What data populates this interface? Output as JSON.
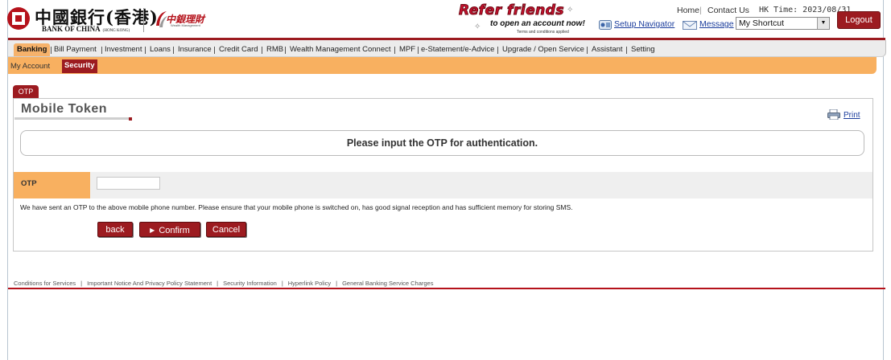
{
  "brand": {
    "name_cn": "中國銀行(香港)",
    "name_en": "BANK OF CHINA",
    "name_en_small": "(HONG KONG)",
    "wealth_cn": "中銀理財",
    "wealth_en": "Wealth Management"
  },
  "promo": {
    "headline": "Refer friends",
    "sub": "to open an account now!",
    "terms": "Terms and conditions applied"
  },
  "header": {
    "home": "Home",
    "contact": "Contact Us",
    "time_label": "HK Time: 2023/08/31",
    "setup_navigator": "Setup Navigator",
    "message": "Message",
    "shortcut_value": "My Shortcut",
    "logout": "Logout"
  },
  "menu": [
    {
      "label": "Banking"
    },
    {
      "label": "Bill Payment"
    },
    {
      "label": "Investment"
    },
    {
      "label": "Loans"
    },
    {
      "label": "Insurance"
    },
    {
      "label": "Credit Card"
    },
    {
      "label": "RMB"
    },
    {
      "label": "Wealth Management Connect"
    },
    {
      "label": "MPF"
    },
    {
      "label": "e-Statement/e-Advice"
    },
    {
      "label": "Upgrade / Open Service"
    },
    {
      "label": "Assistant"
    },
    {
      "label": "Setting"
    }
  ],
  "submenu": [
    {
      "label": "My Account"
    },
    {
      "label": "Security"
    }
  ],
  "page": {
    "tab": "OTP",
    "title": "Mobile Token",
    "print": "Print",
    "prompt": "Please input the OTP for authentication.",
    "otp_label": "OTP",
    "notice": "We have sent an OTP to the above mobile phone number. Please ensure that your mobile phone is switched on, has good signal reception and has sufficient memory for storing SMS.",
    "back": "back",
    "confirm": "Confirm",
    "cancel": "Cancel"
  },
  "footer": [
    "Conditions for Services",
    "Important Notice And Privacy Policy Statement",
    "Security Information",
    "Hyperlink Policy",
    "General Banking Service Charges"
  ],
  "colors": {
    "brand_red": "#9c1b20",
    "accent_orange": "#f8b060",
    "link_blue": "#1a3c9c"
  }
}
